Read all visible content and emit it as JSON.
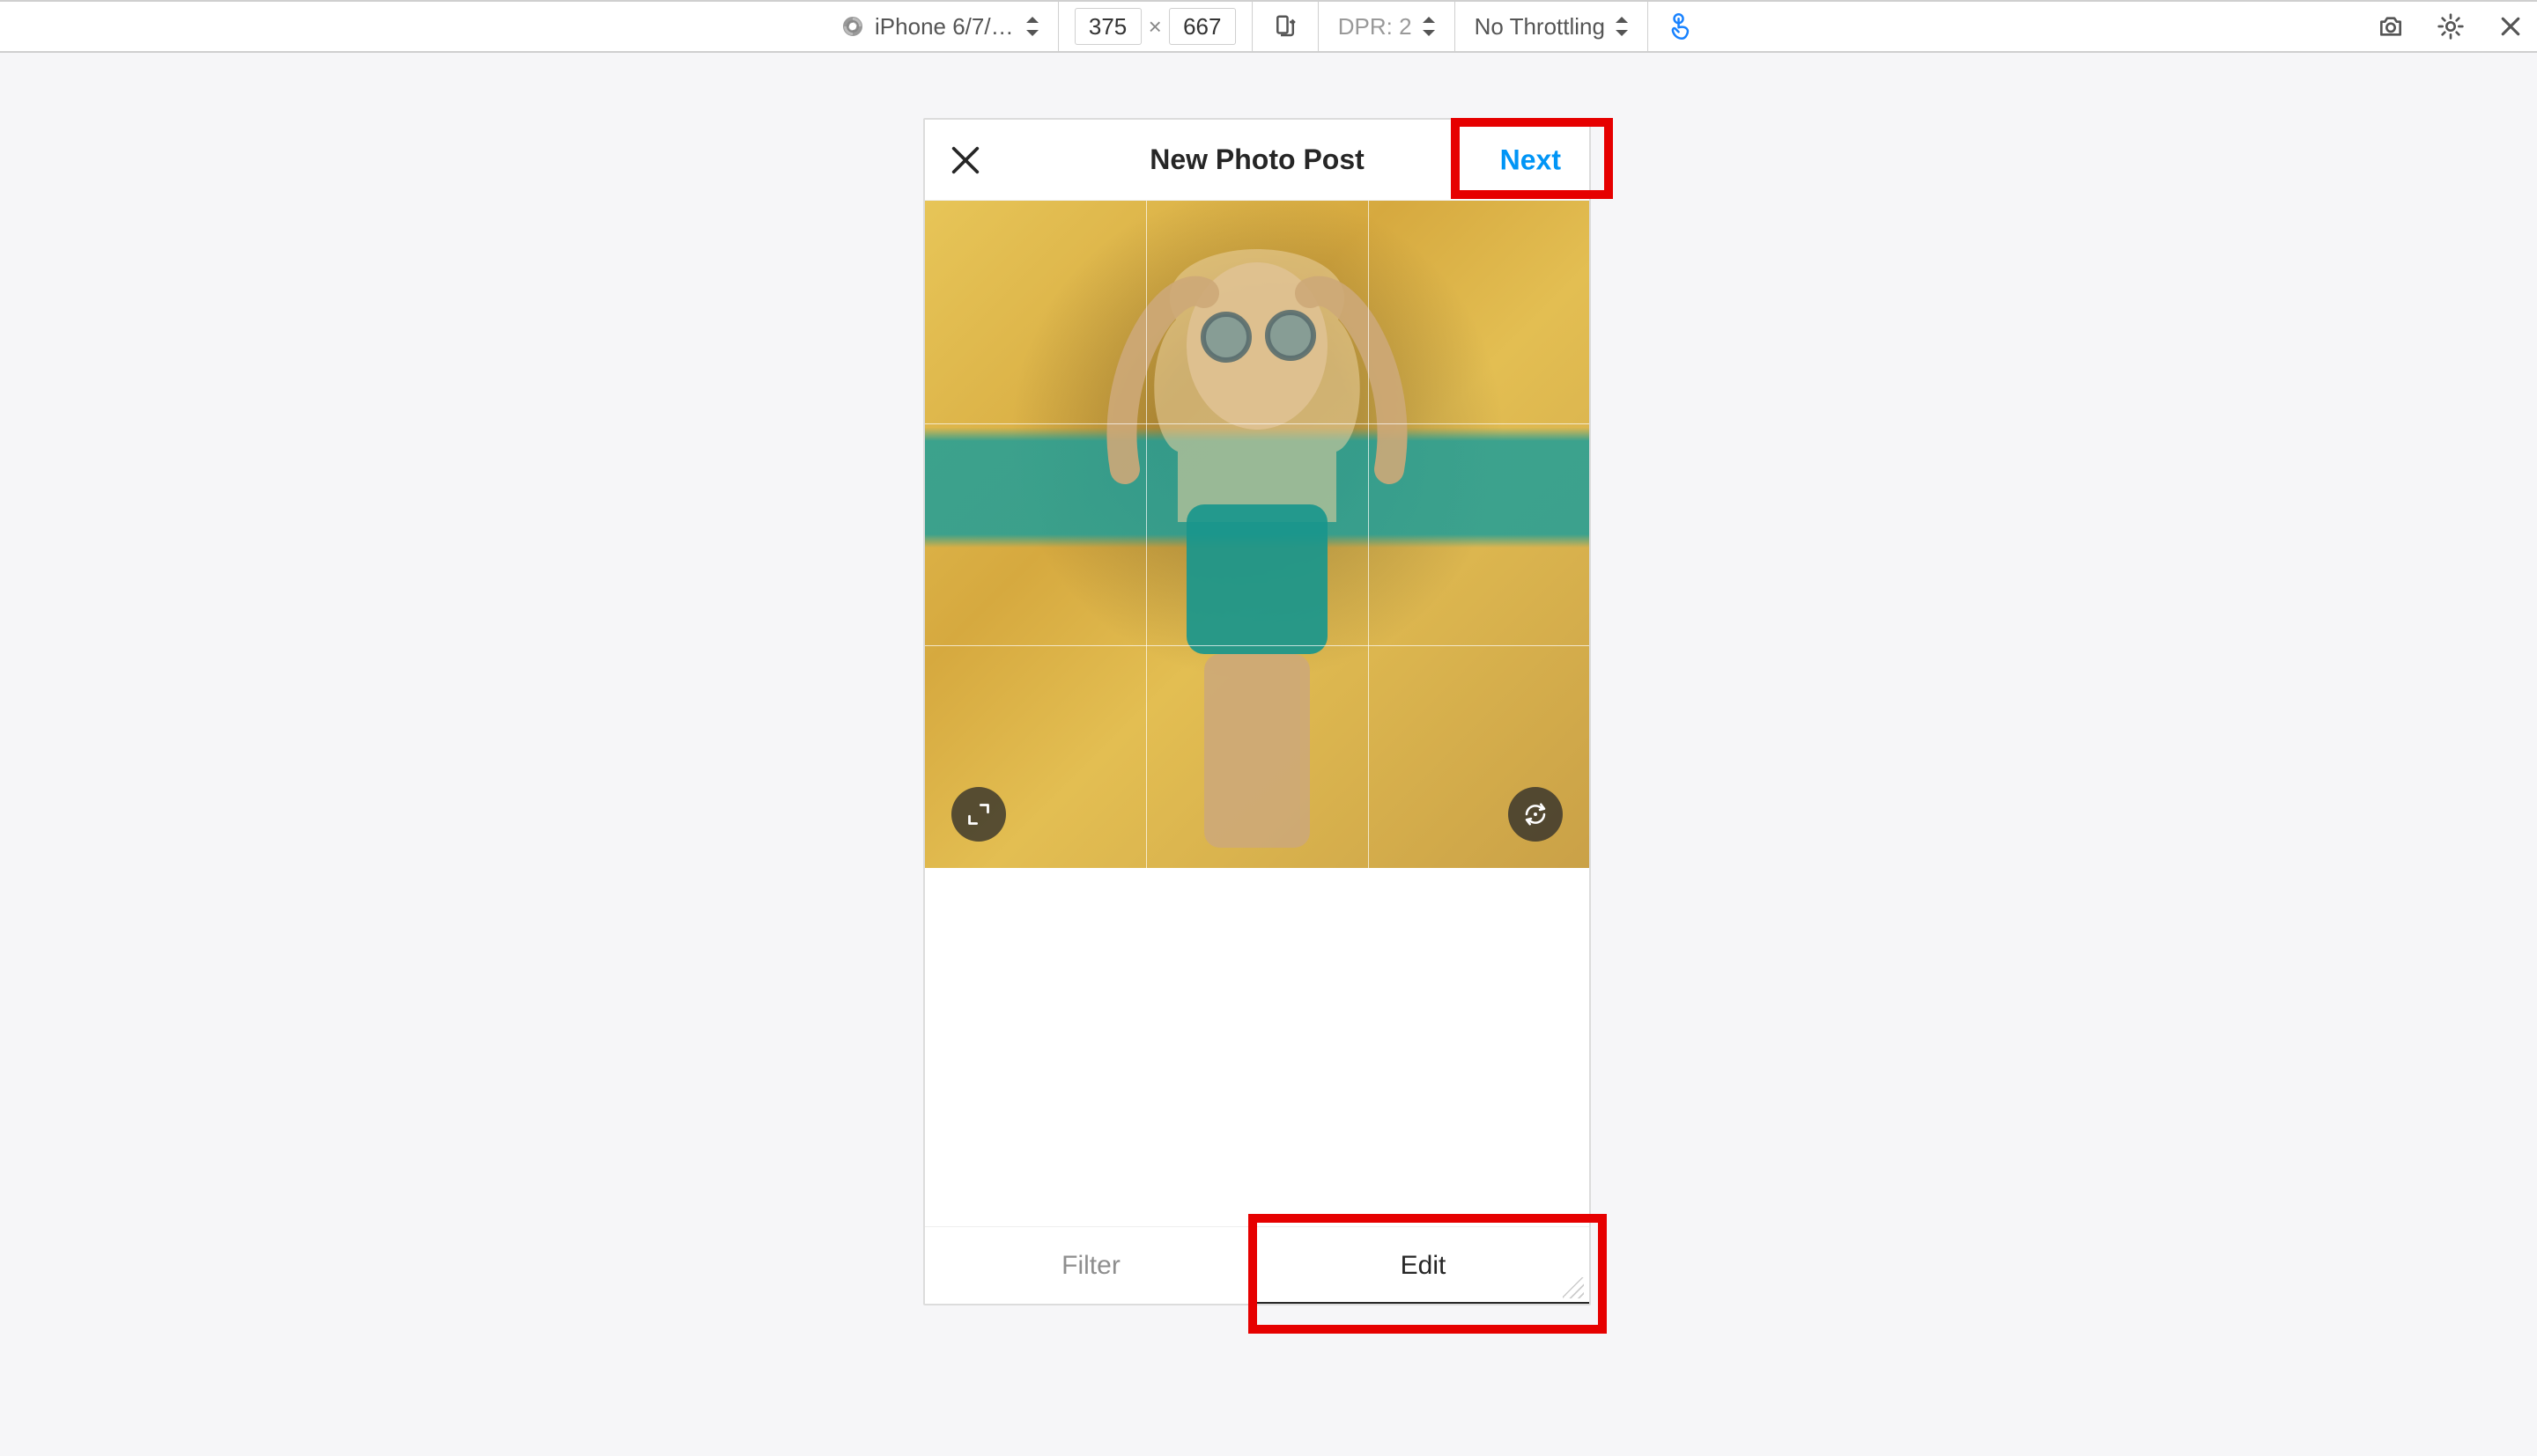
{
  "devtools": {
    "device_label": "iPhone 6/7/…",
    "width": "375",
    "height": "667",
    "dpr_label": "DPR: 2",
    "throttle_label": "No Throttling"
  },
  "app": {
    "title": "New Photo Post",
    "next_label": "Next",
    "tabs": {
      "filter": "Filter",
      "edit": "Edit"
    }
  }
}
